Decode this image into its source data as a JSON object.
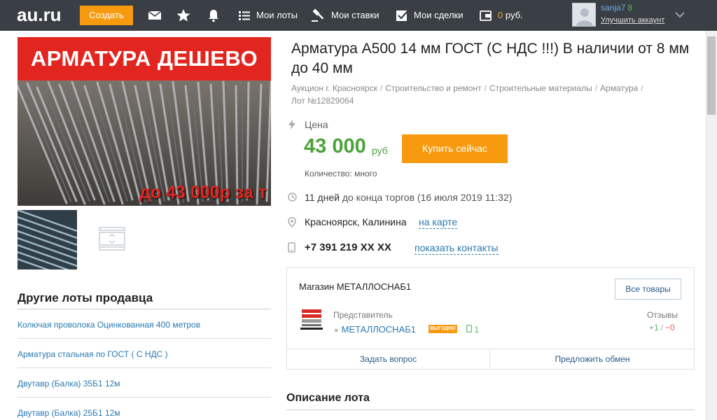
{
  "header": {
    "logo": "au.ru",
    "create_label": "Создать",
    "nav": {
      "my_lots": "Мои лоты",
      "my_bids": "Мои ставки",
      "my_deals": "Мои сделки",
      "balance_value": "0",
      "balance_unit": "руб."
    },
    "user": {
      "name": "sanja7",
      "rating": "8",
      "upgrade_link": "Улучшить аккаунт"
    },
    "icons": [
      "mail-icon",
      "star-icon",
      "bell-icon",
      "list-icon",
      "gavel-icon",
      "checkbox-icon",
      "wallet-icon",
      "chevron-down-icon"
    ]
  },
  "gallery": {
    "banner_text": "АРМАТУРА ДЕШЕВО",
    "overlay_text": "до 43 000р за т"
  },
  "other_lots": {
    "heading": "Другие лоты продавца",
    "items": [
      "Колючая проволока Оцинкованная 400 метров",
      "Арматура стальная по ГОСТ ( С НДС )",
      "Двутавр (Балка) 35Б1 12м",
      "Двутавр (Балка) 25Б1 12м"
    ]
  },
  "lot": {
    "title": "Арматура А500 14 мм ГОСТ (С НДС !!!) В наличии от 8 мм до 40 мм",
    "breadcrumbs": [
      "Аукцион г. Красноярск",
      "Строительство и ремонт",
      "Строительные материалы",
      "Арматура"
    ],
    "lot_number": "Лот №12829064",
    "price_label": "Цена",
    "price": "43 000",
    "currency": "руб",
    "buy_label": "Купить сейчас",
    "quantity": "Количество: много",
    "days_left": "11 дней",
    "days_suffix": "до конца торгов",
    "end_date": "(16 июля 2019 11:32)",
    "location": "Красноярск, Калинина",
    "map_link": "на карте",
    "phone": "+7 391 219 XX XX",
    "contacts_link": "показать контакты"
  },
  "shop": {
    "name": "Магазин МЕТАЛЛОСНАБ1",
    "all_goods": "Все товары",
    "rep_label": "Представитель",
    "seller": "МЕТАЛЛОСНАБ1",
    "badge": "ВЫГОДНО",
    "phone_count": "1",
    "reviews_label": "Отзывы",
    "reviews_pos": "+1",
    "reviews_neg": "−0",
    "ask": "Задать вопрос",
    "offer_swap": "Предложить обмен"
  },
  "description": {
    "heading": "Описание лота"
  },
  "colors": {
    "topbar": "#3a3f45",
    "accent_orange": "#f79a0f",
    "price_green": "#4aa33a",
    "link_blue": "#2a7ab0",
    "banner_red": "#e3251f"
  }
}
